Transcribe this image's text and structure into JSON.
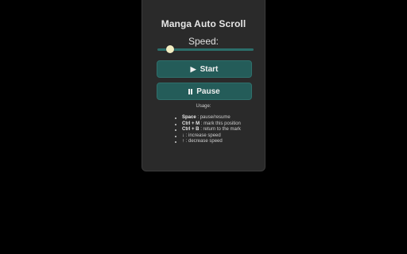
{
  "app": {
    "title": "Manga Auto Scroll"
  },
  "speed": {
    "label": "Speed:",
    "value_fraction": 0.13
  },
  "buttons": {
    "start_icon": "▶",
    "start_label": "Start",
    "pause_label": "Pause"
  },
  "usage": {
    "title": "Usage:",
    "items": [
      {
        "key": "Space",
        "desc": ": pause/resume"
      },
      {
        "key": "Ctrl + M",
        "desc": ": mark this position"
      },
      {
        "key": "Ctrl + B",
        "desc": ": return to the mark"
      },
      {
        "key": "↓",
        "desc": ": increase speed"
      },
      {
        "key": "↑",
        "desc": ": decrease speed"
      }
    ]
  },
  "colors": {
    "accent": "#245c59",
    "panel": "#2a2a2a",
    "thumb": "#f2edc2"
  },
  "icons": {
    "start": "play-icon",
    "pause": "pause-icon"
  }
}
